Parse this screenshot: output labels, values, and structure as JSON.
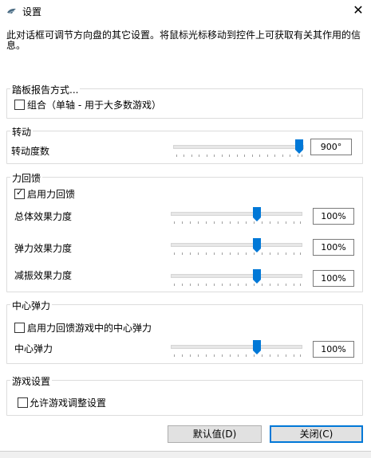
{
  "window": {
    "title": "设置",
    "close_glyph": "✕"
  },
  "description": "此对话框可调节方向盘的其它设置。将鼠标光标移动到控件上可获取有关其作用的信息。",
  "pedal": {
    "group_label": "踏板报告方式...",
    "combine_checkbox": {
      "label": "组合（单轴 - 用于大多数游戏）",
      "checked": false
    }
  },
  "rotation": {
    "group_label": "转动",
    "degree_label": "转动度数",
    "degree_value": "900°",
    "degree_fraction": 1.0
  },
  "force_feedback": {
    "group_label": "力回馈",
    "enable_checkbox": {
      "label": "启用力回馈",
      "checked": true
    },
    "sliders": [
      {
        "label": "总体效果力度",
        "value": "100%",
        "fraction": 0.5
      },
      {
        "label": "弹力效果力度",
        "value": "100%",
        "fraction": 0.5
      },
      {
        "label": "减振效果力度",
        "value": "100%",
        "fraction": 0.5
      }
    ]
  },
  "centering": {
    "group_label": "中心弹力",
    "enable_checkbox": {
      "label": "启用力回馈游戏中的中心弹力",
      "checked": false
    },
    "strength_label": "中心弹力",
    "strength_value": "100%",
    "strength_fraction": 0.5
  },
  "game_settings": {
    "group_label": "游戏设置",
    "allow_checkbox": {
      "label": "允许游戏调整设置",
      "checked": false
    }
  },
  "buttons": {
    "defaults": "默认值(D)",
    "close": "关闭(C)"
  },
  "colors": {
    "accent": "#0078d7",
    "border": "#dcdcdc"
  }
}
